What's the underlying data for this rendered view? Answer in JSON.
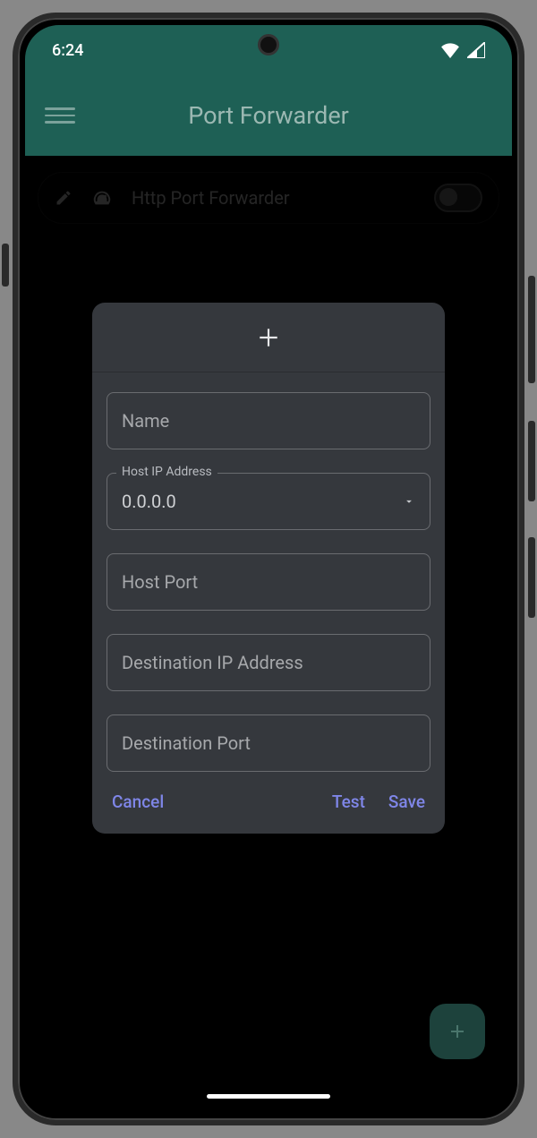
{
  "status": {
    "time": "6:24"
  },
  "header": {
    "title": "Port Forwarder"
  },
  "list": {
    "items": [
      {
        "label": "Http Port Forwarder",
        "enabled": false
      }
    ]
  },
  "dialog": {
    "fields": {
      "name_placeholder": "Name",
      "host_ip_label": "Host IP Address",
      "host_ip_value": "0.0.0.0",
      "host_port_placeholder": "Host Port",
      "dest_ip_placeholder": "Destination IP Address",
      "dest_port_placeholder": "Destination Port"
    },
    "actions": {
      "cancel": "Cancel",
      "test": "Test",
      "save": "Save"
    }
  },
  "colors": {
    "brand": "#1e6055",
    "accent": "#7f86e8",
    "dialog_bg": "#35383d"
  }
}
